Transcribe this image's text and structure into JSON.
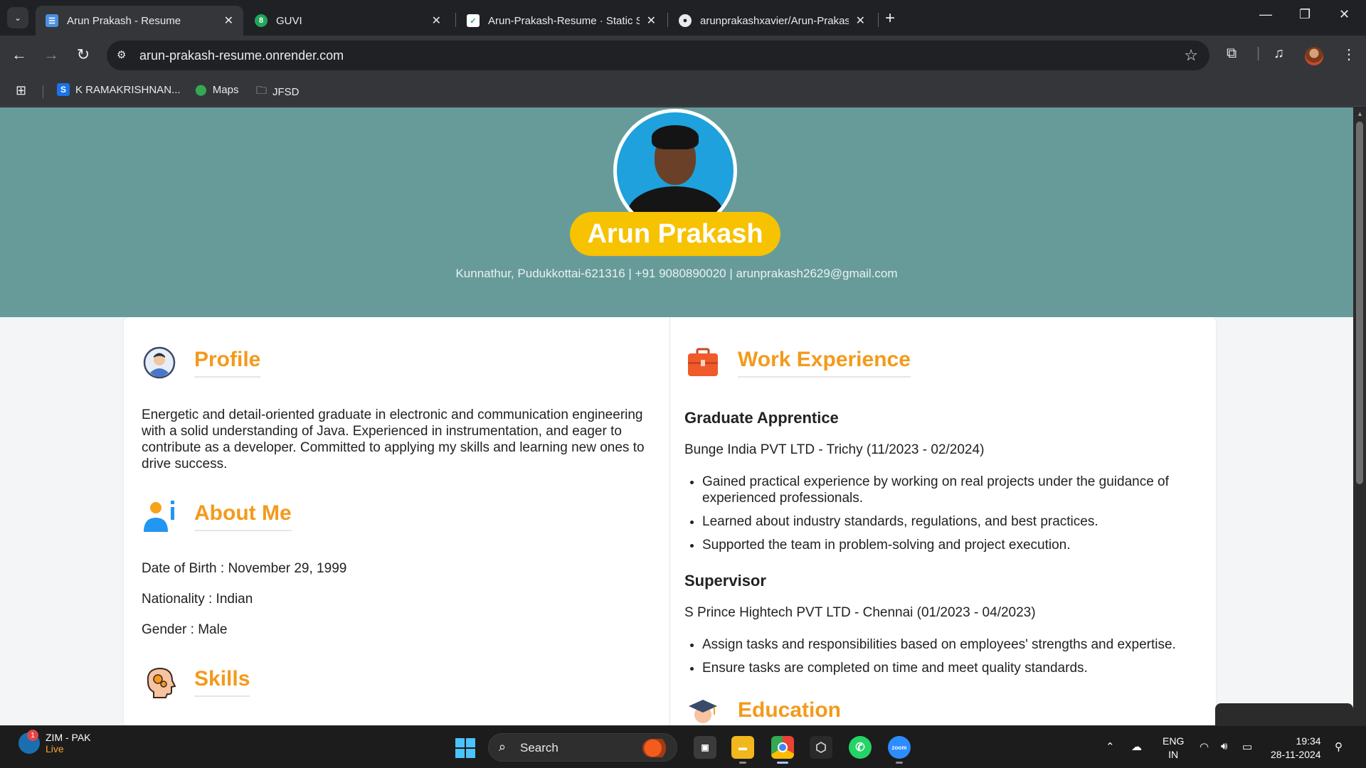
{
  "browser": {
    "tabs": [
      {
        "title": "Arun Prakash - Resume",
        "active": true
      },
      {
        "title": "GUVI",
        "active": false
      },
      {
        "title": "Arun-Prakash-Resume · Static S",
        "active": false
      },
      {
        "title": "arunprakashxavier/Arun-Prakas",
        "active": false
      }
    ],
    "guvi_badge": "8",
    "url": "arun-prakash-resume.onrender.com",
    "bookmarks": [
      {
        "label": "K RAMAKRISHNAN...",
        "icon": "s-logo-icon"
      },
      {
        "label": "Maps",
        "icon": "maps-pin-icon"
      },
      {
        "label": "JFSD",
        "icon": "folder-icon"
      }
    ],
    "s_logo": "S"
  },
  "resume": {
    "name": "Arun Prakash",
    "contact": "Kunnathur, Pudukkottai-621316 | +91 9080890020 | arunprakash2629@gmail.com",
    "profile": {
      "title": "Profile",
      "text": "Energetic and detail-oriented graduate in electronic and communication engineering with a solid understanding of Java. Experienced in instrumentation, and eager to contribute as a developer. Committed to applying my skills and learning new ones to drive success."
    },
    "about": {
      "title": "About Me",
      "dob": "Date of Birth : November 29, 1999",
      "nationality": "Nationality : Indian",
      "gender": "Gender : Male"
    },
    "skills": {
      "title": "Skills"
    },
    "work": {
      "title": "Work Experience",
      "jobs": [
        {
          "role": "Graduate Apprentice",
          "company": "Bunge India PVT LTD - Trichy (11/2023 - 02/2024)",
          "points": [
            "Gained practical experience by working on real projects under the guidance of experienced professionals.",
            "Learned about industry standards, regulations, and best practices.",
            "Supported the team in problem-solving and project execution."
          ]
        },
        {
          "role": "Supervisor",
          "company": "S Prince Hightech PVT LTD - Chennai (01/2023 - 04/2023)",
          "points": [
            "Assign tasks and responsibilities based on employees' strengths and expertise.",
            "Ensure tasks are completed on time and meet quality standards."
          ]
        }
      ]
    },
    "education": {
      "title": "Education"
    }
  },
  "taskbar": {
    "widget_title": "ZIM - PAK",
    "widget_status": "Live",
    "widget_badge": "1",
    "search_label": "Search",
    "lang_line1": "ENG",
    "lang_line2": "IN",
    "time": "19:34",
    "date": "28-11-2024",
    "zoom_label": "zoom"
  },
  "colors": {
    "hero_bg": "#679b9a",
    "name_pill": "#f7c200",
    "section_title": "#f39a1b"
  }
}
